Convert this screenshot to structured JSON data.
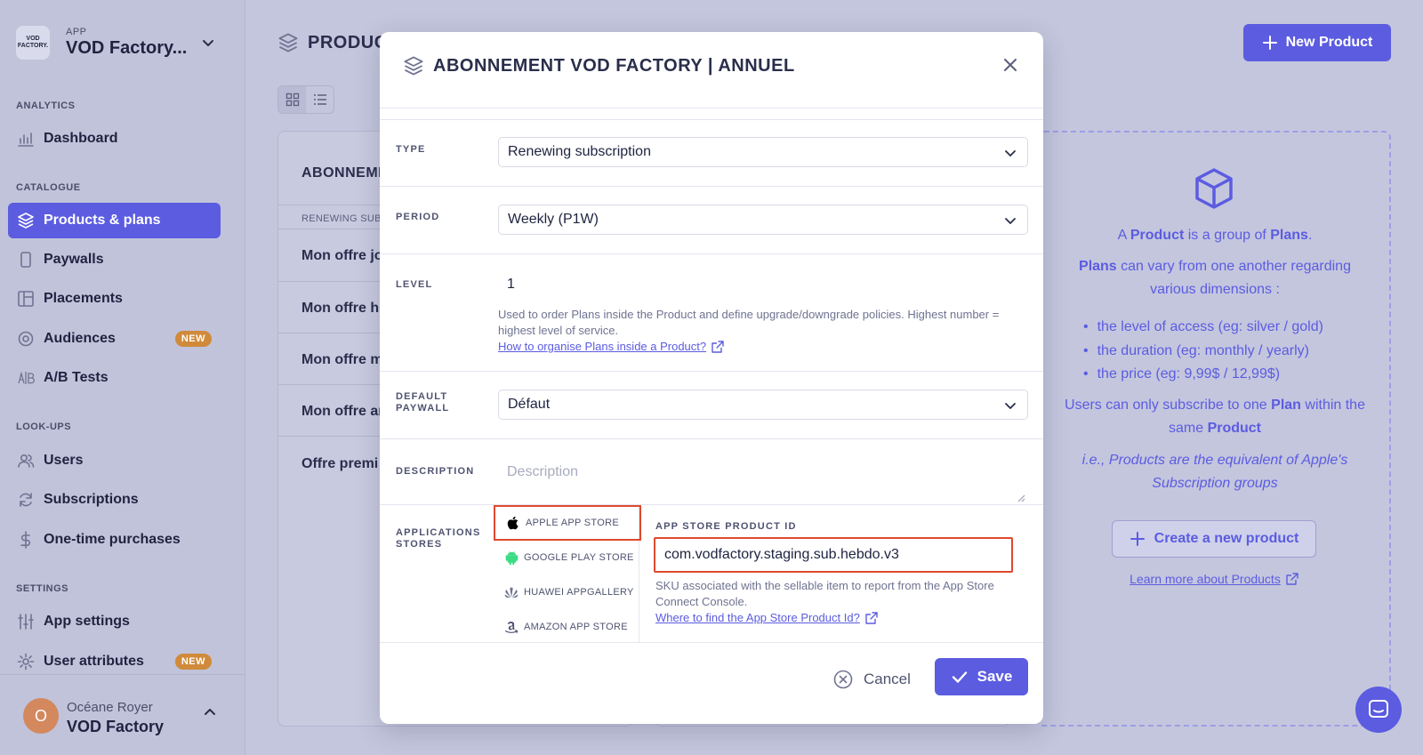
{
  "sidebar": {
    "app_kicker": "APP",
    "app_name": "VOD Factory...",
    "app_logo_line1": "VOD",
    "app_logo_line2": "FACTORY.",
    "sections": {
      "analytics": "ANALYTICS",
      "catalogue": "CATALOGUE",
      "lookups": "LOOK-UPS",
      "settings": "SETTINGS"
    },
    "items": {
      "dashboard": "Dashboard",
      "products": "Products & plans",
      "paywalls": "Paywalls",
      "placements": "Placements",
      "audiences": "Audiences",
      "ab_tests": "A/B Tests",
      "users": "Users",
      "subscriptions": "Subscriptions",
      "one_time": "One-time purchases",
      "app_settings": "App settings",
      "user_attributes": "User attributes"
    },
    "new_badge": "NEW",
    "user": {
      "initial": "O",
      "name": "Océane Royer",
      "org": "VOD Factory"
    }
  },
  "page": {
    "title": "PRODUC",
    "new_product_label": "New Product"
  },
  "product_card": {
    "title": "ABONNEME",
    "subtitle": "RENEWING SUBS",
    "plans": [
      "Mon offre jo",
      "Mon offre h",
      "Mon offre m",
      "Mon offre ar",
      "Offre premi"
    ]
  },
  "info_panel": {
    "line1_a": "A ",
    "line1_b": "Product",
    "line1_c": " is a group of ",
    "line1_d": "Plans",
    "line1_e": ".",
    "line2_a": "Plans",
    "line2_b": " can vary from one another regarding various dimensions :",
    "bullets": [
      "the level of access (eg: silver / gold)",
      "the duration (eg: monthly / yearly)",
      "the price (eg: 9,99$ / 12,99$)"
    ],
    "line3_a": "Users can only subscribe to one ",
    "line3_b": "Plan",
    "line3_c": " within the same ",
    "line3_d": "Product",
    "line4": "i.e., Products are the equivalent of Apple's Subscription groups",
    "create_label": "Create a new product",
    "learn_label": "Learn more about Products"
  },
  "modal": {
    "title": "ABONNEMENT VOD FACTORY | ANNUEL",
    "type_label": "TYPE",
    "type_value": "Renewing subscription",
    "period_label": "PERIOD",
    "period_value": "Weekly (P1W)",
    "level_label": "LEVEL",
    "level_value": "1",
    "level_help": "Used to order Plans inside the Product and define upgrade/downgrade policies. Highest number = highest level of service.",
    "level_link": "How to organise Plans inside a Product?",
    "paywall_label_1": "DEFAULT",
    "paywall_label_2": "PAYWALL",
    "paywall_value": "Défaut",
    "description_label": "DESCRIPTION",
    "description_placeholder": "Description",
    "stores_label_1": "APPLICATIONS",
    "stores_label_2": "STORES",
    "stores": {
      "apple": "APPLE APP STORE",
      "google": "GOOGLE PLAY STORE",
      "huawei": "HUAWEI APPGALLERY",
      "amazon": "AMAZON APP STORE"
    },
    "store_field_label": "APP STORE PRODUCT ID",
    "store_field_value": "com.vodfactory.staging.sub.hebdo.v3",
    "store_help": "SKU associated with the sellable item to report from the App Store Connect Console.",
    "store_link": "Where to find the App Store Product Id?",
    "cancel_label": "Cancel",
    "save_label": "Save"
  },
  "colors": {
    "accent": "#5b5ce0",
    "highlight": "#e0492f",
    "new_badge": "#d08a3a"
  }
}
